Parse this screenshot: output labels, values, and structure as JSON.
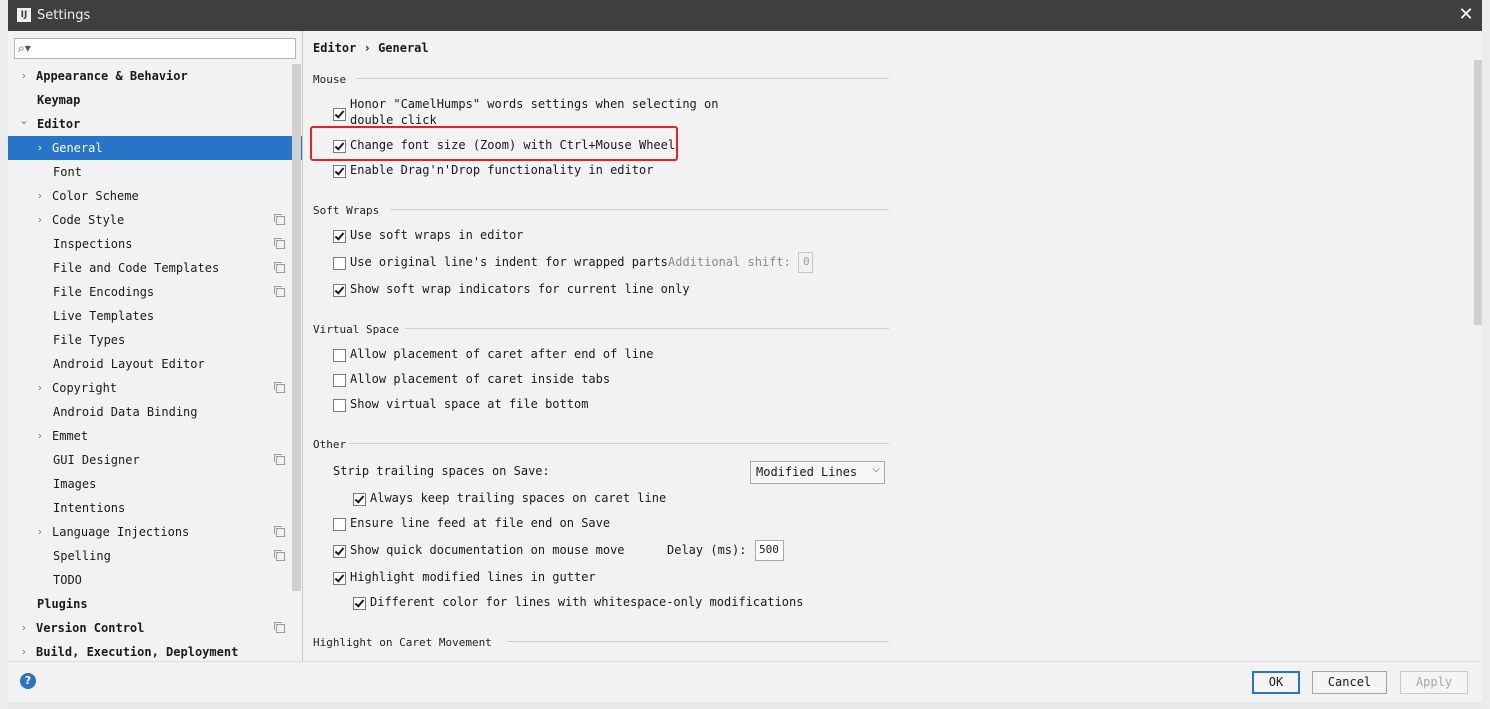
{
  "window": {
    "title": "Settings",
    "app_icon": "IJ"
  },
  "search": {
    "placeholder": ""
  },
  "sidebar": {
    "items": [
      {
        "label": "Appearance & Behavior",
        "arrow": "›"
      },
      {
        "label": "Keymap"
      },
      {
        "label": "Editor",
        "arrow": "⌄"
      },
      {
        "label": "General",
        "arrow": "›"
      },
      {
        "label": "Font"
      },
      {
        "label": "Color Scheme",
        "arrow": "›"
      },
      {
        "label": "Code Style",
        "arrow": "›"
      },
      {
        "label": "Inspections"
      },
      {
        "label": "File and Code Templates"
      },
      {
        "label": "File Encodings"
      },
      {
        "label": "Live Templates"
      },
      {
        "label": "File Types"
      },
      {
        "label": "Android Layout Editor"
      },
      {
        "label": "Copyright",
        "arrow": "›"
      },
      {
        "label": "Android Data Binding"
      },
      {
        "label": "Emmet",
        "arrow": "›"
      },
      {
        "label": "GUI Designer"
      },
      {
        "label": "Images"
      },
      {
        "label": "Intentions"
      },
      {
        "label": "Language Injections",
        "arrow": "›"
      },
      {
        "label": "Spelling"
      },
      {
        "label": "TODO"
      },
      {
        "label": "Plugins"
      },
      {
        "label": "Version Control",
        "arrow": "›"
      },
      {
        "label": "Build, Execution, Deployment",
        "arrow": "›"
      }
    ]
  },
  "breadcrumb": {
    "parent": "Editor",
    "sep": "›",
    "current": "General"
  },
  "mouse": {
    "title": "Mouse",
    "camel_humps_line1": "Honor \"CamelHumps\" words settings when selecting on",
    "camel_humps_line2": "double click",
    "change_font_size": "Change font size (Zoom) with Ctrl+Mouse Wheel",
    "drag_drop": "Enable Drag'n'Drop functionality in editor"
  },
  "soft_wraps": {
    "title": "Soft Wraps",
    "use_soft_wraps": "Use soft wraps in editor",
    "original_indent": "Use original line's indent for wrapped parts",
    "additional_shift_label": "Additional shift:",
    "additional_shift_value": "0",
    "show_indicators": "Show soft wrap indicators for current line only"
  },
  "virtual_space": {
    "title": "Virtual Space",
    "after_end": "Allow placement of caret after end of line",
    "inside_tabs": "Allow placement of caret inside tabs",
    "file_bottom": "Show virtual space at file bottom"
  },
  "other": {
    "title": "Other",
    "strip_label": "Strip trailing spaces on Save:",
    "strip_value": "Modified Lines",
    "keep_trailing": "Always keep trailing spaces on caret line",
    "ensure_line_feed": "Ensure line feed at file end on Save",
    "quick_doc": "Show quick documentation on mouse move",
    "delay_label": "Delay (ms):",
    "delay_value": "500",
    "highlight_modified": "Highlight modified lines in gutter",
    "different_color": "Different color for lines with whitespace-only modifications"
  },
  "highlight_caret": {
    "title": "Highlight on Caret Movement"
  },
  "footer": {
    "help": "?",
    "ok": "OK",
    "cancel": "Cancel",
    "apply": "Apply"
  },
  "colors": {
    "selection": "#2874c8",
    "highlight_box": "#e02424",
    "title_bar": "#3f3f3f"
  }
}
